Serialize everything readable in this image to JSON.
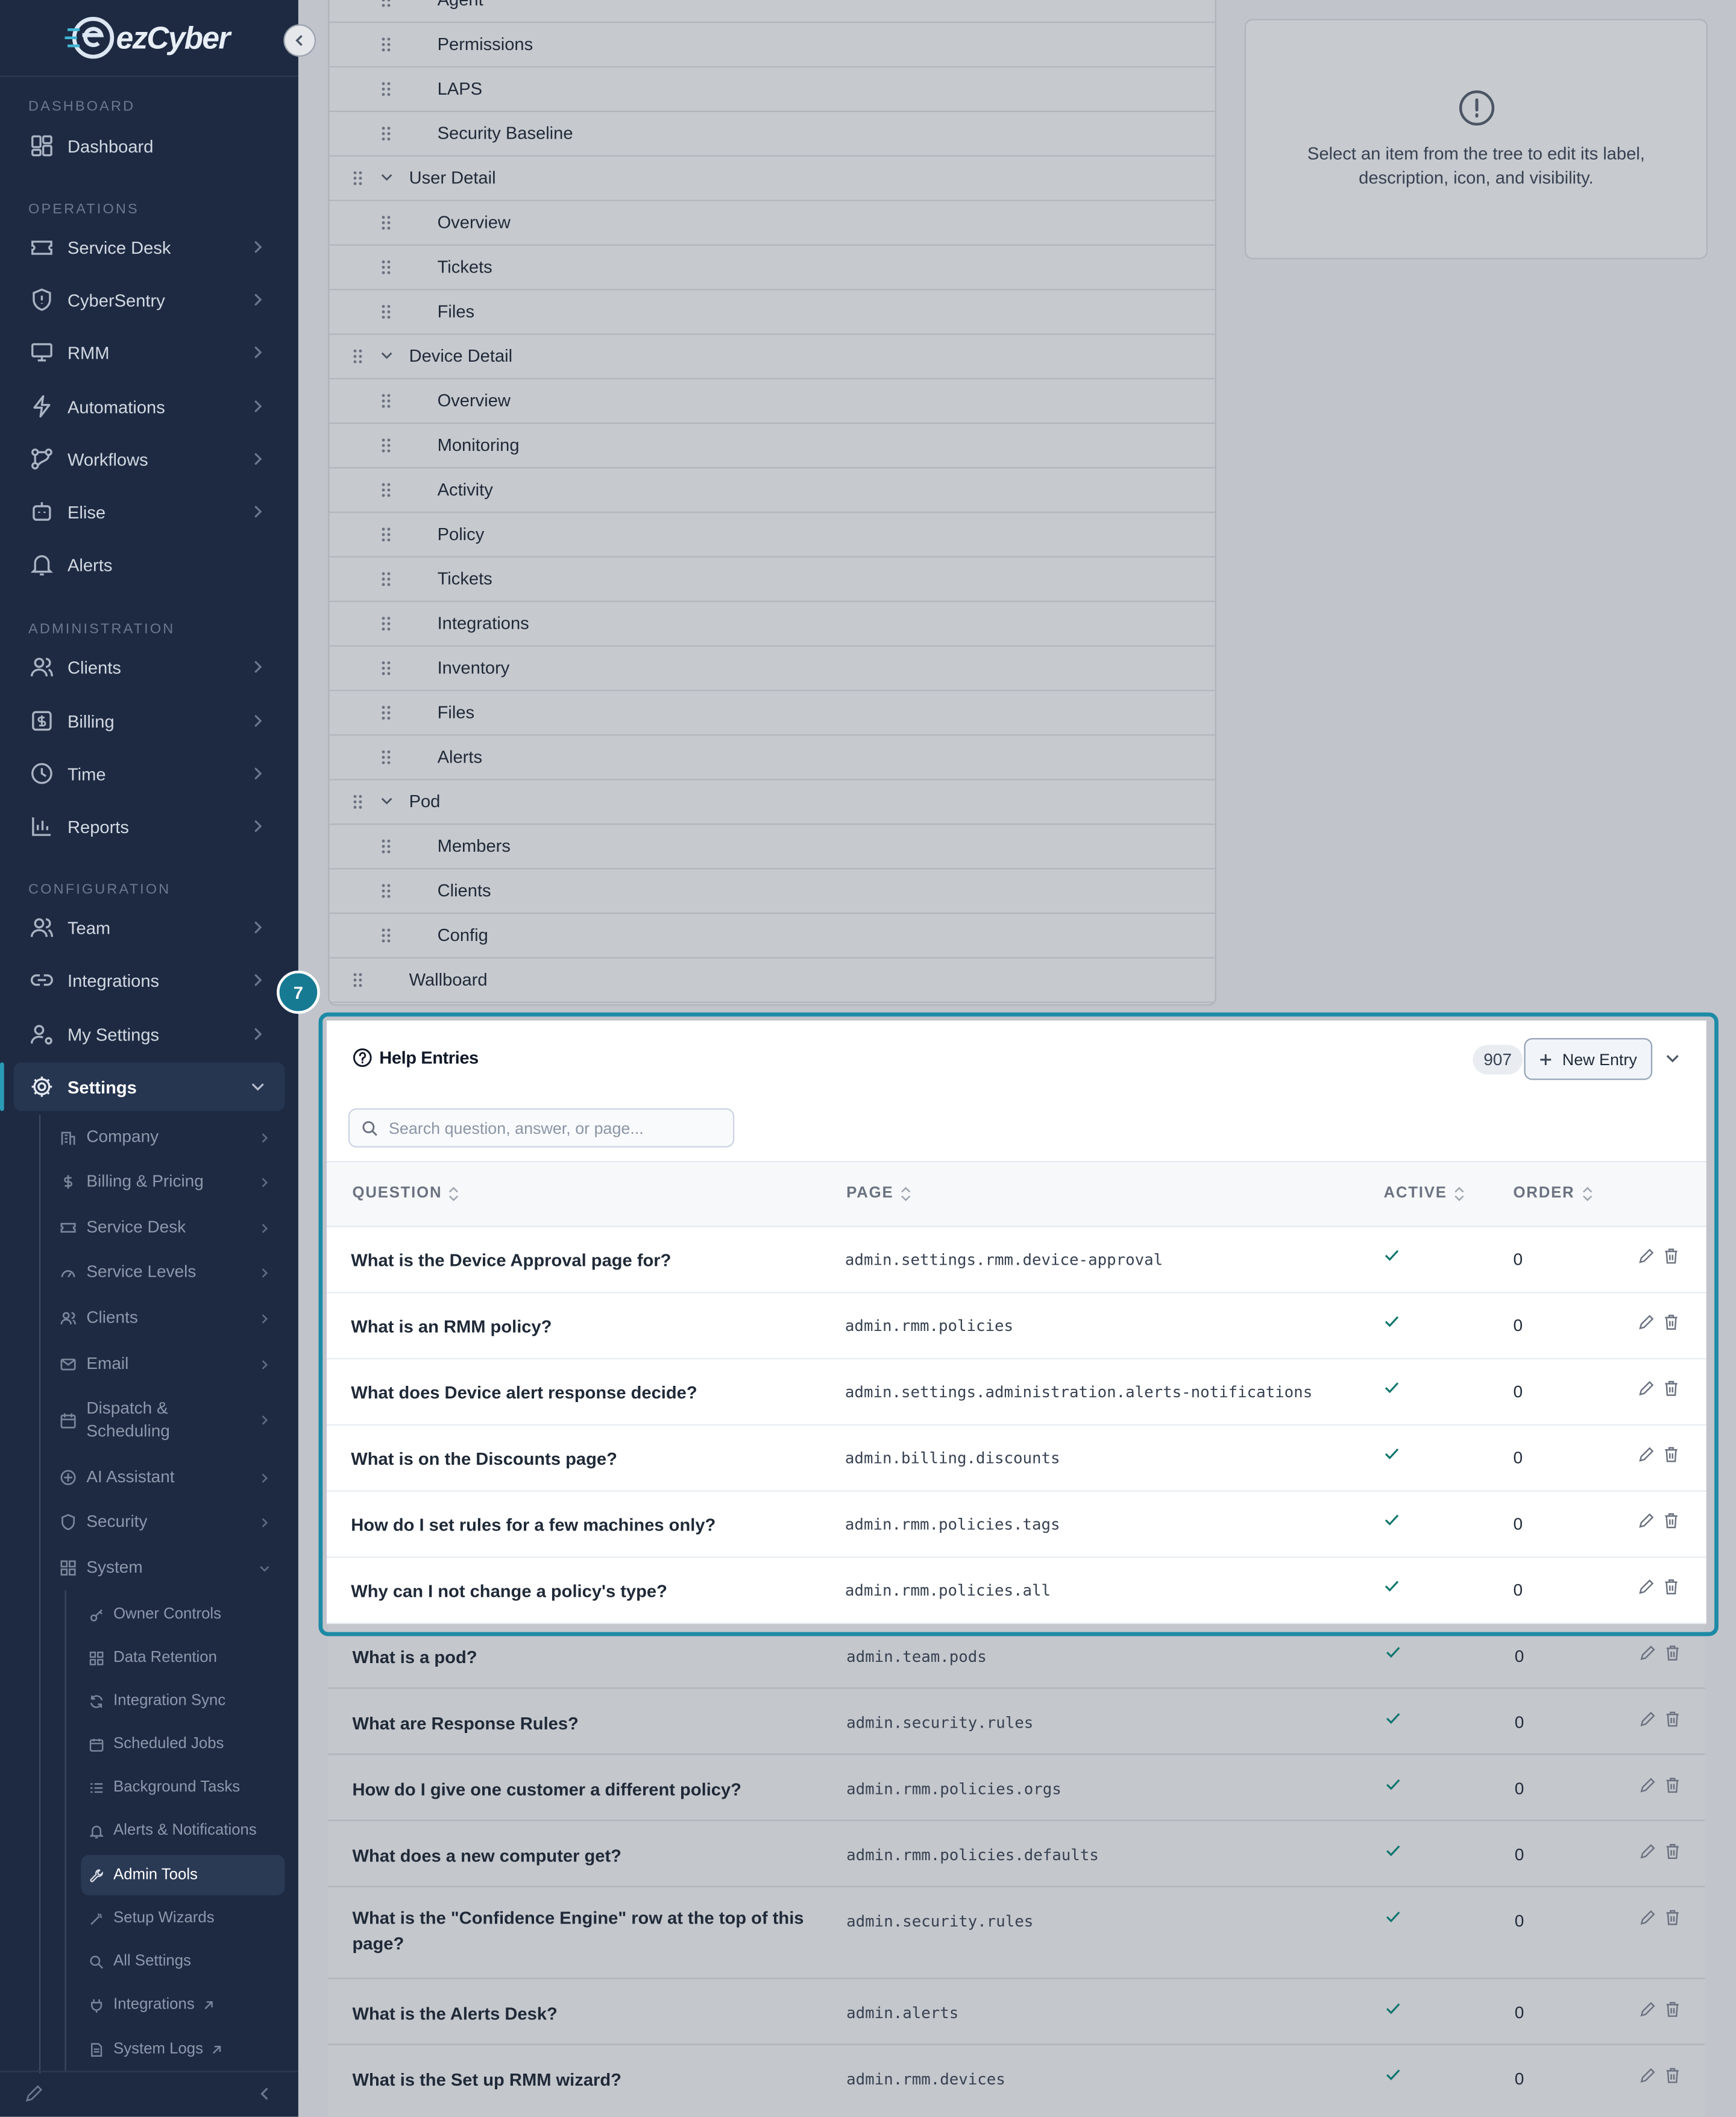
{
  "brand": {
    "logo_text": "ezCyber"
  },
  "sidebar": {
    "sections": {
      "dashboard": "DASHBOARD",
      "operations": "OPERATIONS",
      "administration": "ADMINISTRATION",
      "configuration": "CONFIGURATION"
    },
    "items": {
      "dashboard": "Dashboard",
      "service_desk": "Service Desk",
      "cybersentry": "CyberSentry",
      "rmm": "RMM",
      "automations": "Automations",
      "workflows": "Workflows",
      "elise": "Elise",
      "alerts": "Alerts",
      "clients": "Clients",
      "billing": "Billing",
      "time": "Time",
      "reports": "Reports",
      "team": "Team",
      "integrations": "Integrations",
      "my_settings": "My Settings",
      "settings": "Settings"
    },
    "settings_sub": {
      "company": "Company",
      "billing_pricing": "Billing & Pricing",
      "service_desk": "Service Desk",
      "service_levels": "Service Levels",
      "clients": "Clients",
      "email": "Email",
      "dispatch_line1": "Dispatch &",
      "dispatch_line2": "Scheduling",
      "ai_assistant": "AI Assistant",
      "security": "Security",
      "system": "System"
    },
    "system_sub": {
      "owner_controls": "Owner Controls",
      "data_retention": "Data Retention",
      "integration_sync": "Integration Sync",
      "scheduled_jobs": "Scheduled Jobs",
      "background_tasks": "Background Tasks",
      "alerts_notifications": "Alerts & Notifications",
      "admin_tools": "Admin Tools",
      "setup_wizards": "Setup Wizards",
      "all_settings": "All Settings",
      "integrations": "Integrations",
      "system_logs": "System Logs"
    }
  },
  "tree": {
    "top_partial": "Agent",
    "rows": [
      {
        "label": "Permissions",
        "level": 2
      },
      {
        "label": "LAPS",
        "level": 2
      },
      {
        "label": "Security Baseline",
        "level": 2
      },
      {
        "label": "User Detail",
        "level": 1
      },
      {
        "label": "Overview",
        "level": 2
      },
      {
        "label": "Tickets",
        "level": 2
      },
      {
        "label": "Files",
        "level": 2
      },
      {
        "label": "Device Detail",
        "level": 1
      },
      {
        "label": "Overview",
        "level": 2
      },
      {
        "label": "Monitoring",
        "level": 2
      },
      {
        "label": "Activity",
        "level": 2
      },
      {
        "label": "Policy",
        "level": 2
      },
      {
        "label": "Tickets",
        "level": 2
      },
      {
        "label": "Integrations",
        "level": 2
      },
      {
        "label": "Inventory",
        "level": 2
      },
      {
        "label": "Files",
        "level": 2
      },
      {
        "label": "Alerts",
        "level": 2
      },
      {
        "label": "Pod",
        "level": 1
      },
      {
        "label": "Members",
        "level": 2
      },
      {
        "label": "Clients",
        "level": 2
      },
      {
        "label": "Config",
        "level": 2
      },
      {
        "label": "Wallboard",
        "level": 0
      }
    ]
  },
  "info_card": {
    "text": "Select an item from the tree to edit its label, description, icon, and visibility."
  },
  "highlight": {
    "step_number": "7"
  },
  "help_entries": {
    "title": "Help Entries",
    "count": "907",
    "new_button": "New Entry",
    "search_placeholder": "Search question, answer, or page...",
    "columns": {
      "question": "QUESTION",
      "page": "PAGE",
      "active": "ACTIVE",
      "order": "ORDER"
    },
    "rows": [
      {
        "question": "What is the Device Approval page for?",
        "page": "admin.settings.rmm.device-approval",
        "active": true,
        "order": "0"
      },
      {
        "question": "What is an RMM policy?",
        "page": "admin.rmm.policies",
        "active": true,
        "order": "0"
      },
      {
        "question": "What does Device alert response decide?",
        "page": "admin.settings.administration.alerts-notifications",
        "active": true,
        "order": "0"
      },
      {
        "question": "What is on the Discounts page?",
        "page": "admin.billing.discounts",
        "active": true,
        "order": "0"
      },
      {
        "question": "How do I set rules for a few machines only?",
        "page": "admin.rmm.policies.tags",
        "active": true,
        "order": "0"
      },
      {
        "question": "Why can I not change a policy's type?",
        "page": "admin.rmm.policies.all",
        "active": true,
        "order": "0"
      }
    ],
    "more_rows": [
      {
        "question": "What is a pod?",
        "page": "admin.team.pods",
        "active": true,
        "order": "0"
      },
      {
        "question": "What are Response Rules?",
        "page": "admin.security.rules",
        "active": true,
        "order": "0"
      },
      {
        "question": "How do I give one customer a different policy?",
        "page": "admin.rmm.policies.orgs",
        "active": true,
        "order": "0"
      },
      {
        "question": "What does a new computer get?",
        "page": "admin.rmm.policies.defaults",
        "active": true,
        "order": "0"
      },
      {
        "question_line1": "What is the \"Confidence Engine\" row at the top of this",
        "question_line2": "page?",
        "page": "admin.security.rules",
        "active": true,
        "order": "0"
      },
      {
        "question": "What is the Alerts Desk?",
        "page": "admin.alerts",
        "active": true,
        "order": "0"
      },
      {
        "question": "What is the Set up RMM wizard?",
        "page": "admin.rmm.devices",
        "active": true,
        "order": "0"
      }
    ]
  },
  "colors": {
    "sidebar_bg": "#1d2a42",
    "accent": "#1d8aa6",
    "badge": "#177a93",
    "main_dim": "#c1c4ca"
  }
}
